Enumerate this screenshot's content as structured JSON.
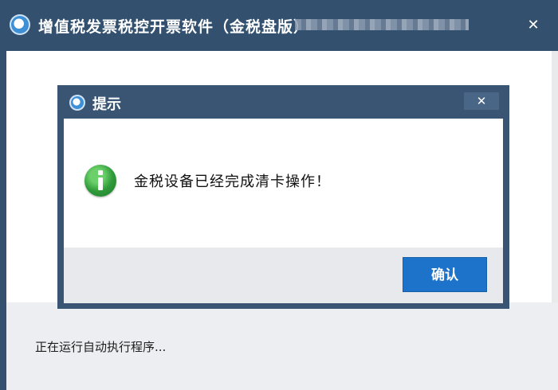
{
  "main_window": {
    "title": "增值税发票税控开票软件（金税盘版）",
    "close_glyph": "✕",
    "status_text": "正在运行自动执行程序..."
  },
  "dialog": {
    "title": "提示",
    "close_glyph": "✕",
    "message": "金税设备已经完成清卡操作！",
    "icon": "info-icon",
    "ok_label": "确认"
  },
  "colors": {
    "titlebar": "#33506f",
    "button": "#1d73c9",
    "info_icon": "#2f9a3a"
  }
}
